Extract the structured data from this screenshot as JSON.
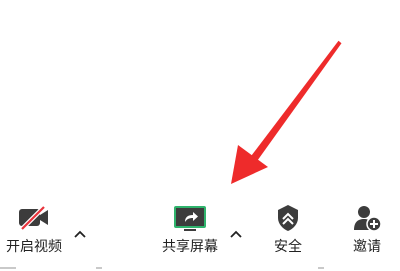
{
  "toolbar": {
    "items": [
      {
        "label": "开启视频",
        "icon": "video-off-icon",
        "has_caret": true
      },
      {
        "label": "共享屏幕",
        "icon": "share-screen-icon",
        "has_caret": true
      },
      {
        "label": "安全",
        "icon": "security-shield-icon",
        "has_caret": false
      },
      {
        "label": "邀请",
        "icon": "invite-person-icon",
        "has_caret": false
      }
    ]
  },
  "colors": {
    "icon": "#3c3c3c",
    "video_off_slash": "#e8333c",
    "share_screen_accent": "#2fb36c",
    "arrow": "#ee2b2b",
    "label": "#222222"
  }
}
